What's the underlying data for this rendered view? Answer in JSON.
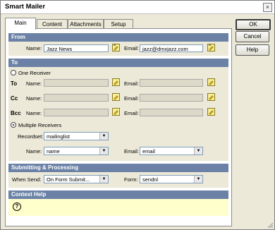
{
  "window": {
    "title": "Smart Mailer"
  },
  "tabs": [
    "Main",
    "Content",
    "Attachments",
    "Setup"
  ],
  "buttons": {
    "ok": "OK",
    "cancel": "Cancel",
    "help": "Help"
  },
  "from": {
    "header": "From",
    "name_label": "Name:",
    "name_value": "Jazz News",
    "email_label": "Email:",
    "email_value": "jazz@dmxjazz.com"
  },
  "to": {
    "header": "To",
    "one_receiver": "One Receiver",
    "rows": [
      {
        "label": "To",
        "name_label": "Name:",
        "email_label": "Email:"
      },
      {
        "label": "Cc",
        "name_label": "Name:",
        "email_label": "Email:"
      },
      {
        "label": "Bcc",
        "name_label": "Name:",
        "email_label": "Email:"
      }
    ],
    "multiple_receivers": "Multiple Receivers",
    "recordset_label": "Recordset:",
    "recordset_value": "mailinglist",
    "name_label": "Name:",
    "name_value": "name",
    "email_label": "Email:",
    "email_value": "email"
  },
  "submit": {
    "header": "Submitting & Processing",
    "when_label": "When Send:",
    "when_value": "On Form Submit...",
    "form_label": "Form:",
    "form_value": "sendnl"
  },
  "context": {
    "header": "Context Help",
    "help_glyph": "?"
  },
  "colors": {
    "section_header": "#6b82a6",
    "help_area": "#ffffcc",
    "dialog_bg": "#ece9d8"
  }
}
